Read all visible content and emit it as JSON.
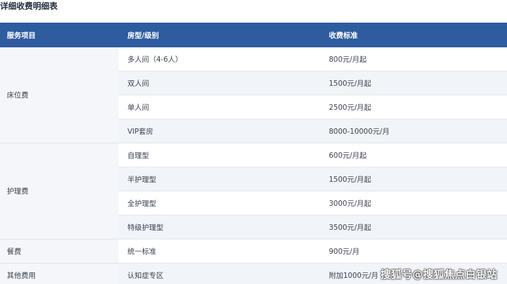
{
  "title": "详细收费明细表",
  "table": {
    "headers": [
      "服务项目",
      "房型/级别",
      "收费标准"
    ],
    "groups": [
      {
        "category": "床位费",
        "rows": [
          {
            "level": "多人间（4-6人）",
            "price": "800元/月起"
          },
          {
            "level": "双人间",
            "price": "1500元/月起"
          },
          {
            "level": "单人间",
            "price": "2500元/月起"
          },
          {
            "level": "VIP套房",
            "price": "8000-10000元/月"
          }
        ]
      },
      {
        "category": "护理费",
        "rows": [
          {
            "level": "自理型",
            "price": "600元/月起"
          },
          {
            "level": "半护理型",
            "price": "1500元/月起"
          },
          {
            "level": "全护理型",
            "price": "3000元/月起"
          },
          {
            "level": "特级护理型",
            "price": "3500元/月起"
          }
        ]
      },
      {
        "category": "餐费",
        "rows": [
          {
            "level": "统一标准",
            "price": "900元/月"
          }
        ]
      },
      {
        "category": "其他费用",
        "rows": [
          {
            "level": "认知症专区",
            "price": "附加1000元/月"
          }
        ]
      }
    ]
  },
  "watermark": "搜狐号@搜狐焦点白银站"
}
